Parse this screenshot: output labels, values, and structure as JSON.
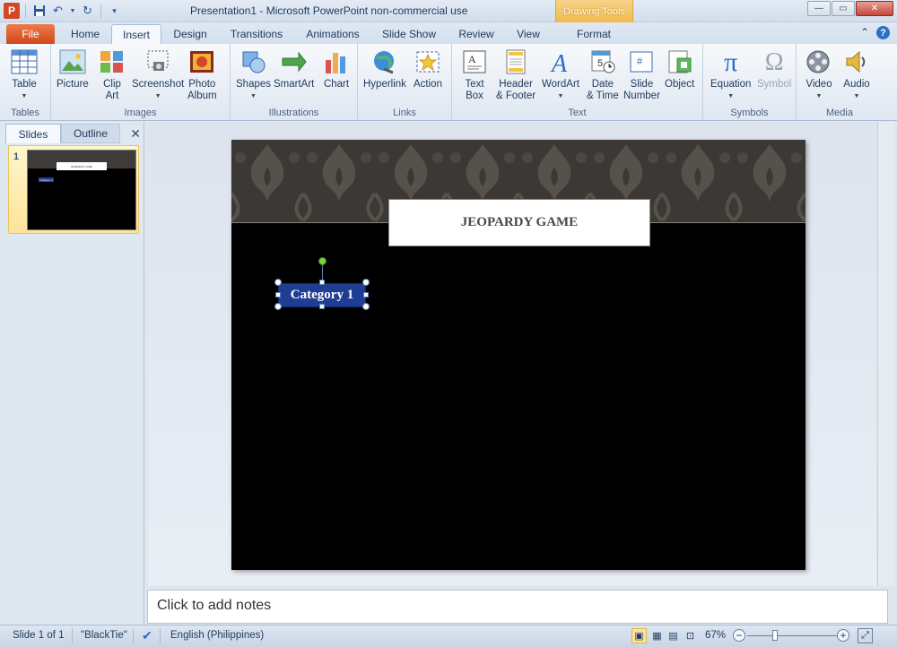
{
  "app": {
    "title": "Presentation1  -  Microsoft PowerPoint non-commercial use",
    "contextual_tab_group": "Drawing Tools",
    "logo_letter": "P"
  },
  "tabs": [
    {
      "label": "File"
    },
    {
      "label": "Home"
    },
    {
      "label": "Insert"
    },
    {
      "label": "Design"
    },
    {
      "label": "Transitions"
    },
    {
      "label": "Animations"
    },
    {
      "label": "Slide Show"
    },
    {
      "label": "Review"
    },
    {
      "label": "View"
    },
    {
      "label": "Format"
    }
  ],
  "active_tab": "Insert",
  "ribbon": {
    "groups": {
      "tables": "Tables",
      "images": "Images",
      "illustrations": "Illustrations",
      "links": "Links",
      "text": "Text",
      "symbols": "Symbols",
      "media": "Media"
    },
    "buttons": {
      "table": "Table",
      "picture": "Picture",
      "clip_art_1": "Clip",
      "clip_art_2": "Art",
      "screenshot": "Screenshot",
      "photo_album_1": "Photo",
      "photo_album_2": "Album",
      "shapes": "Shapes",
      "smartart": "SmartArt",
      "chart": "Chart",
      "hyperlink": "Hyperlink",
      "action": "Action",
      "text_box_1": "Text",
      "text_box_2": "Box",
      "header_footer_1": "Header",
      "header_footer_2": "& Footer",
      "wordart": "WordArt",
      "date_time_1": "Date",
      "date_time_2": "& Time",
      "slide_number_1": "Slide",
      "slide_number_2": "Number",
      "object": "Object",
      "equation": "Equation",
      "symbol": "Symbol",
      "video": "Video",
      "audio": "Audio"
    }
  },
  "left_pane": {
    "tabs": [
      "Slides",
      "Outline"
    ],
    "slides": [
      {
        "number": "1",
        "title": "JEOPARDY GAME",
        "category": "Category 1"
      }
    ]
  },
  "slide": {
    "title": "JEOPARDY GAME",
    "category_box": "Category 1"
  },
  "notes": {
    "placeholder": "Click to add notes"
  },
  "status": {
    "slide_info": "Slide 1 of 1",
    "theme": "\"BlackTie\"",
    "language": "English (Philippines)",
    "zoom": "67%"
  },
  "colors": {
    "file_tab": "#d0481a",
    "category_fill": "#1f3e93",
    "slide_background": "#000000",
    "drawing_tools": "#f2b94c"
  }
}
